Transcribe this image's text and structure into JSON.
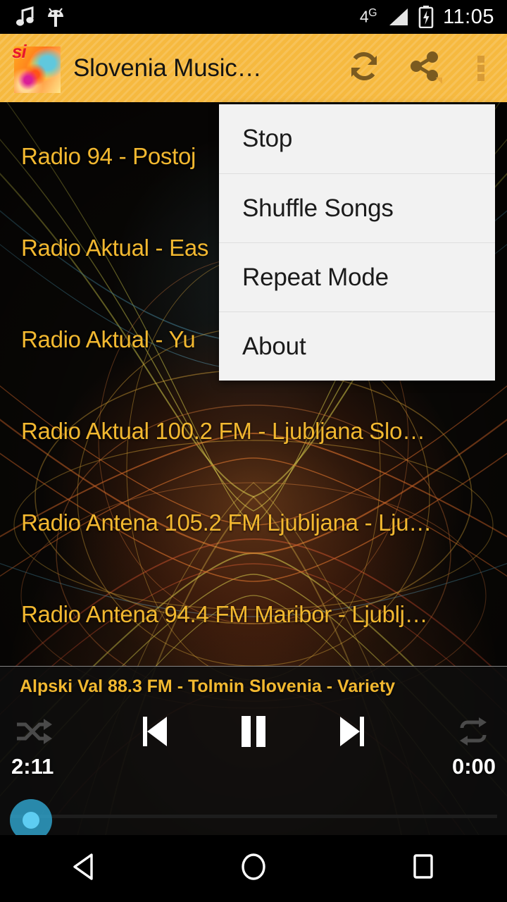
{
  "status_bar": {
    "icons": [
      "music-note-icon",
      "android-debug-icon"
    ],
    "network_type": "4",
    "network_sup": "G",
    "signal": "signal-icon",
    "battery": "battery-charging-icon",
    "clock": "11:05"
  },
  "app_bar": {
    "icon": "app-logo-icon",
    "icon_text": "si",
    "title": "Slovenia Music…",
    "background_color": "#f6b93f",
    "actions": [
      {
        "name": "refresh-button",
        "icon": "refresh-icon"
      },
      {
        "name": "share-button",
        "icon": "share-icon"
      },
      {
        "name": "overflow-button",
        "icon": "more-vertical-icon"
      }
    ]
  },
  "overflow_menu": {
    "visible": true,
    "items": [
      {
        "label": "Stop"
      },
      {
        "label": "Shuffle Songs"
      },
      {
        "label": "Repeat Mode"
      },
      {
        "label": "About"
      }
    ]
  },
  "station_list": {
    "text_color": "#f2b830",
    "items": [
      {
        "label": "Radio 94  - Postoj"
      },
      {
        "label": "Radio Aktual - Eas"
      },
      {
        "label": "Radio Aktual - Yu"
      },
      {
        "label": "Radio Aktual 100.2 FM  - Ljubljana Slo…"
      },
      {
        "label": "Radio Antena 105.2 FM Ljubljana  - Lju…"
      },
      {
        "label": "Radio Antena 94.4 FM Maribor  - Ljublj…"
      }
    ]
  },
  "player": {
    "now_playing": "Alpski Val 88.3 FM   -  Tolmin Slovenia  -  Variety",
    "elapsed": "2:11",
    "total": "0:00",
    "progress_percent": 0,
    "controls": [
      {
        "name": "shuffle-button",
        "icon": "shuffle-icon"
      },
      {
        "name": "previous-button",
        "icon": "skip-previous-icon"
      },
      {
        "name": "play-pause-button",
        "icon": "pause-icon"
      },
      {
        "name": "next-button",
        "icon": "skip-next-icon"
      },
      {
        "name": "repeat-button",
        "icon": "repeat-icon"
      }
    ],
    "thumb_color": "#2fa0c8"
  },
  "nav_bar": {
    "buttons": [
      {
        "name": "back-button",
        "icon": "triangle-back-icon"
      },
      {
        "name": "home-button",
        "icon": "circle-home-icon"
      },
      {
        "name": "recents-button",
        "icon": "square-recents-icon"
      }
    ]
  }
}
